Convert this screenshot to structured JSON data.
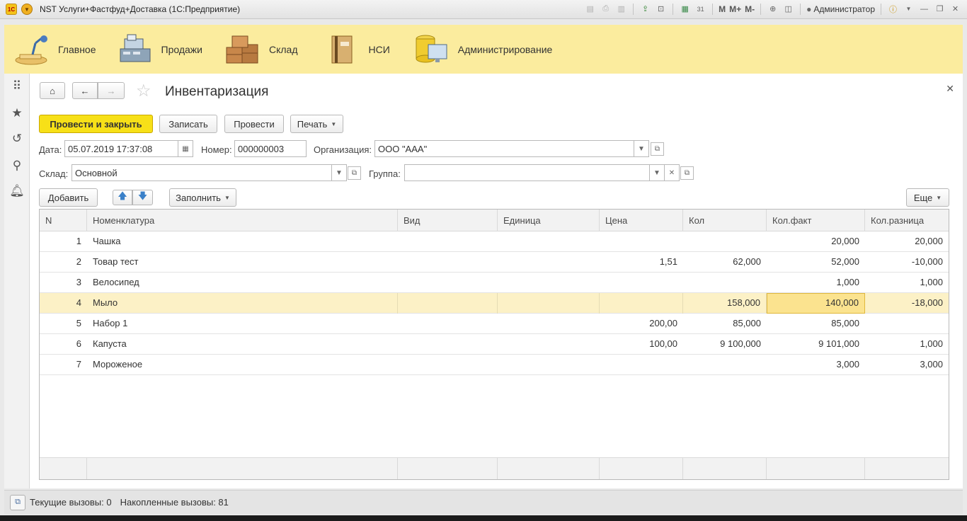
{
  "window": {
    "title": "NST Услуги+Фастфуд+Доставка  (1С:Предприятие)",
    "user": "Администратор",
    "logo_text": "1С",
    "m_labels": [
      "M",
      "M+",
      "M-"
    ]
  },
  "sections": [
    {
      "label": "Главное",
      "icon": "desk-lamp-icon"
    },
    {
      "label": "Продажи",
      "icon": "cash-register-icon"
    },
    {
      "label": "Склад",
      "icon": "boxes-icon"
    },
    {
      "label": "НСИ",
      "icon": "folder-binder-icon"
    },
    {
      "label": "Администрирование",
      "icon": "database-monitor-icon"
    }
  ],
  "form": {
    "title": "Инвентаризация",
    "buttons": {
      "post_close": "Провести и закрыть",
      "save": "Записать",
      "post": "Провести",
      "print": "Печать",
      "add": "Добавить",
      "fill": "Заполнить",
      "more": "Еще"
    },
    "fields": {
      "date_label": "Дата:",
      "date_value": "05.07.2019 17:37:08",
      "number_label": "Номер:",
      "number_value": "000000003",
      "org_label": "Организация:",
      "org_value": "ООО \"AAA\"",
      "warehouse_label": "Склад:",
      "warehouse_value": "Основной",
      "group_label": "Группа:",
      "group_value": ""
    }
  },
  "table": {
    "columns": [
      "N",
      "Номенклатура",
      "Вид",
      "Единица",
      "Цена",
      "Кол",
      "Кол.факт",
      "Кол.разница"
    ],
    "rows": [
      {
        "n": "1",
        "name": "Чашка",
        "kind": "",
        "unit": "",
        "price": "",
        "qty": "",
        "fact": "20,000",
        "diff": "20,000"
      },
      {
        "n": "2",
        "name": "Товар тест",
        "kind": "",
        "unit": "",
        "price": "1,51",
        "qty": "62,000",
        "fact": "52,000",
        "diff": "-10,000"
      },
      {
        "n": "3",
        "name": "Велосипед",
        "kind": "",
        "unit": "",
        "price": "",
        "qty": "",
        "fact": "1,000",
        "diff": "1,000"
      },
      {
        "n": "4",
        "name": "Мыло",
        "kind": "",
        "unit": "",
        "price": "",
        "qty": "158,000",
        "fact": "140,000",
        "diff": "-18,000"
      },
      {
        "n": "5",
        "name": "Набор 1",
        "kind": "",
        "unit": "",
        "price": "200,00",
        "qty": "85,000",
        "fact": "85,000",
        "diff": ""
      },
      {
        "n": "6",
        "name": "Капуста",
        "kind": "",
        "unit": "",
        "price": "100,00",
        "qty": "9 100,000",
        "fact": "9 101,000",
        "diff": "1,000"
      },
      {
        "n": "7",
        "name": "Мороженое",
        "kind": "",
        "unit": "",
        "price": "",
        "qty": "",
        "fact": "3,000",
        "diff": "3,000"
      }
    ],
    "selected_row": 4,
    "active_cell": "fact"
  },
  "status": {
    "current_calls": "Текущие вызовы: 0",
    "accumulated_calls": "Накопленные вызовы: 81"
  },
  "colors": {
    "section_bar": "#fbec9e",
    "primary_button": "#f7e018",
    "selected_row": "#fcf1c6"
  }
}
